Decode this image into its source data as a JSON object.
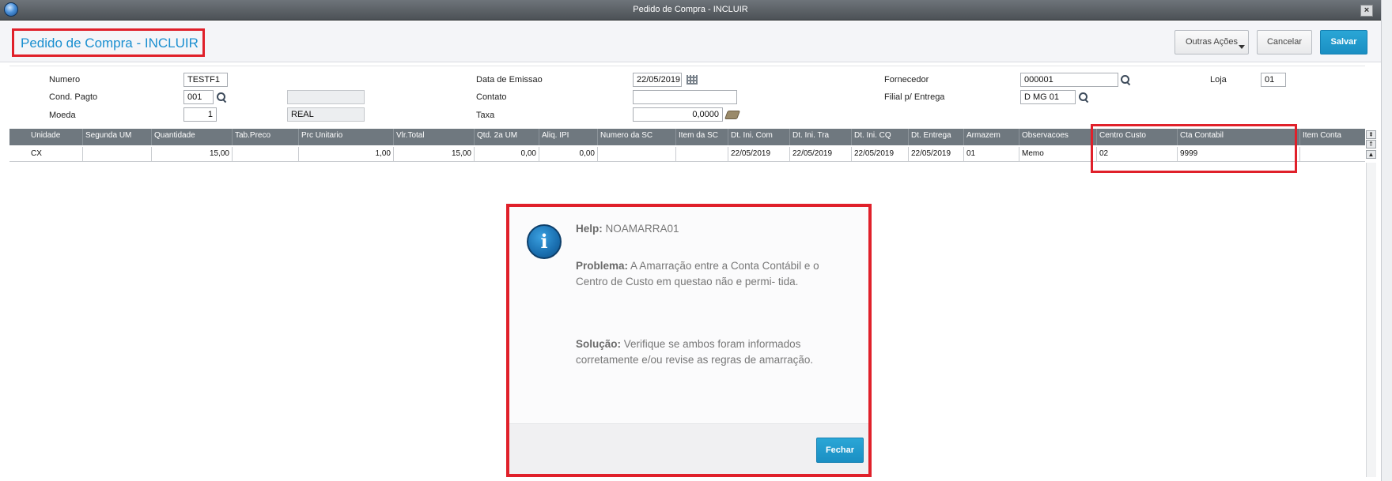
{
  "window": {
    "title": "Pedido de Compra - INCLUIR",
    "close_glyph": "×"
  },
  "header": {
    "page_title": "Pedido de Compra - INCLUIR",
    "buttons": {
      "outras_acoes": "Outras Ações",
      "cancelar": "Cancelar",
      "salvar": "Salvar"
    }
  },
  "form": {
    "numero": {
      "label": "Numero",
      "value": "TESTF1"
    },
    "cond_pagto": {
      "label": "Cond. Pagto",
      "value": "001",
      "desc": ""
    },
    "moeda": {
      "label": "Moeda",
      "value": "1",
      "desc": "REAL"
    },
    "data_emissao": {
      "label": "Data de Emissao",
      "value": "22/05/2019"
    },
    "contato": {
      "label": "Contato",
      "value": ""
    },
    "taxa": {
      "label": "Taxa",
      "value": "0,0000"
    },
    "fornecedor": {
      "label": "Fornecedor",
      "value": "000001"
    },
    "filial_entrega": {
      "label": "Filial p/ Entrega",
      "value": "D MG 01"
    },
    "loja": {
      "label": "Loja",
      "value": "01"
    }
  },
  "grid": {
    "columns": [
      "Unidade",
      "Segunda UM",
      "Quantidade",
      "Tab.Preco",
      "Prc Unitario",
      "Vlr.Total",
      "Qtd. 2a UM",
      "Aliq. IPI",
      "Numero da SC",
      "Item da SC",
      "Dt. Ini. Com",
      "Dt. Ini. Tra",
      "Dt. Ini. CQ",
      "Dt. Entrega",
      "Armazem",
      "Observacoes",
      "Centro Custo",
      "Cta Contabil",
      "Item Conta"
    ],
    "row": [
      "CX",
      "",
      "15,00",
      "",
      "1,00",
      "15,00",
      "0,00",
      "0,00",
      "",
      "",
      "22/05/2019",
      "22/05/2019",
      "22/05/2019",
      "22/05/2019",
      "01",
      "Memo",
      "02",
      "9999",
      ""
    ]
  },
  "help_dialog": {
    "help_label": "Help:",
    "help_code": "NOAMARRA01",
    "problema_label": "Problema:",
    "problema_text": "A Amarração entre a Conta Contábil e o Centro de Custo em questao não e permi- tida.",
    "solucao_label": "Solução:",
    "solucao_text": "Verifique se ambos foram informados corretamente e/ou revise as regras de amarração.",
    "close_label": "Fechar"
  },
  "colors": {
    "accent": "#1a8fd0",
    "highlight": "#e0202a",
    "grid_header": "#6f787f"
  }
}
